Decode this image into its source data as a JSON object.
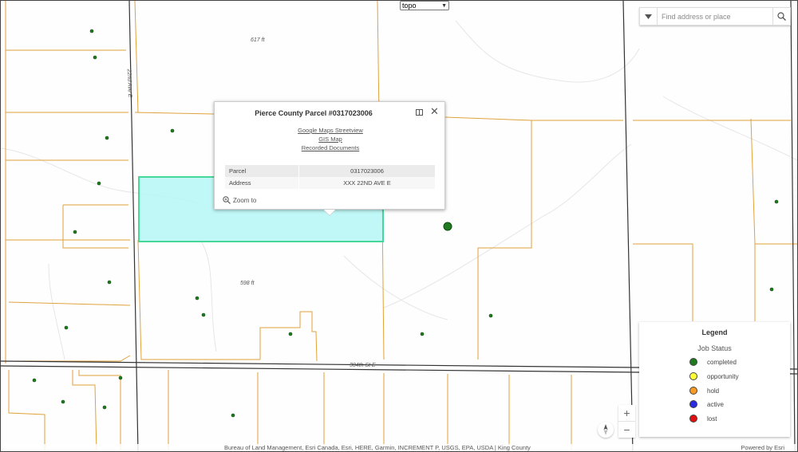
{
  "basemap": {
    "selected": "topo"
  },
  "search": {
    "placeholder": "Find address or place"
  },
  "map_labels": {
    "elev_617": "617 ft",
    "elev_596": "598 ft",
    "road_22nd": "22nd Ave E",
    "road_304th": "304th St E"
  },
  "popup": {
    "title": "Pierce County Parcel #0317023006",
    "links": [
      "Google Maps Streetview",
      "GIS Map",
      "Recorded Documents"
    ],
    "rows": [
      {
        "label": "Parcel",
        "value": "0317023006"
      },
      {
        "label": "Address",
        "value": "XXX 22ND AVE E"
      }
    ],
    "zoom_label": "Zoom to"
  },
  "legend": {
    "title": "Legend",
    "subtitle": "Job Status",
    "items": [
      {
        "label": "completed",
        "color": "#1f7a1f"
      },
      {
        "label": "opportunity",
        "color": "#ffff33"
      },
      {
        "label": "hold",
        "color": "#f59a23"
      },
      {
        "label": "active",
        "color": "#2a2ae0"
      },
      {
        "label": "lost",
        "color": "#e01010"
      }
    ]
  },
  "zoom": {
    "in": "+",
    "out": "−"
  },
  "attribution": {
    "sources": "Bureau of Land Management, Esri Canada, Esri, HERE, Garmin, INCREMENT P, USGS, EPA, USDA | King County",
    "powered": "Powered by Esri"
  },
  "colors": {
    "parcel_line": "#e0a23c",
    "highlight_fill": "#b5f7f7",
    "highlight_stroke": "#47d79a",
    "road": "#333333",
    "point": "#1f7a1f"
  }
}
